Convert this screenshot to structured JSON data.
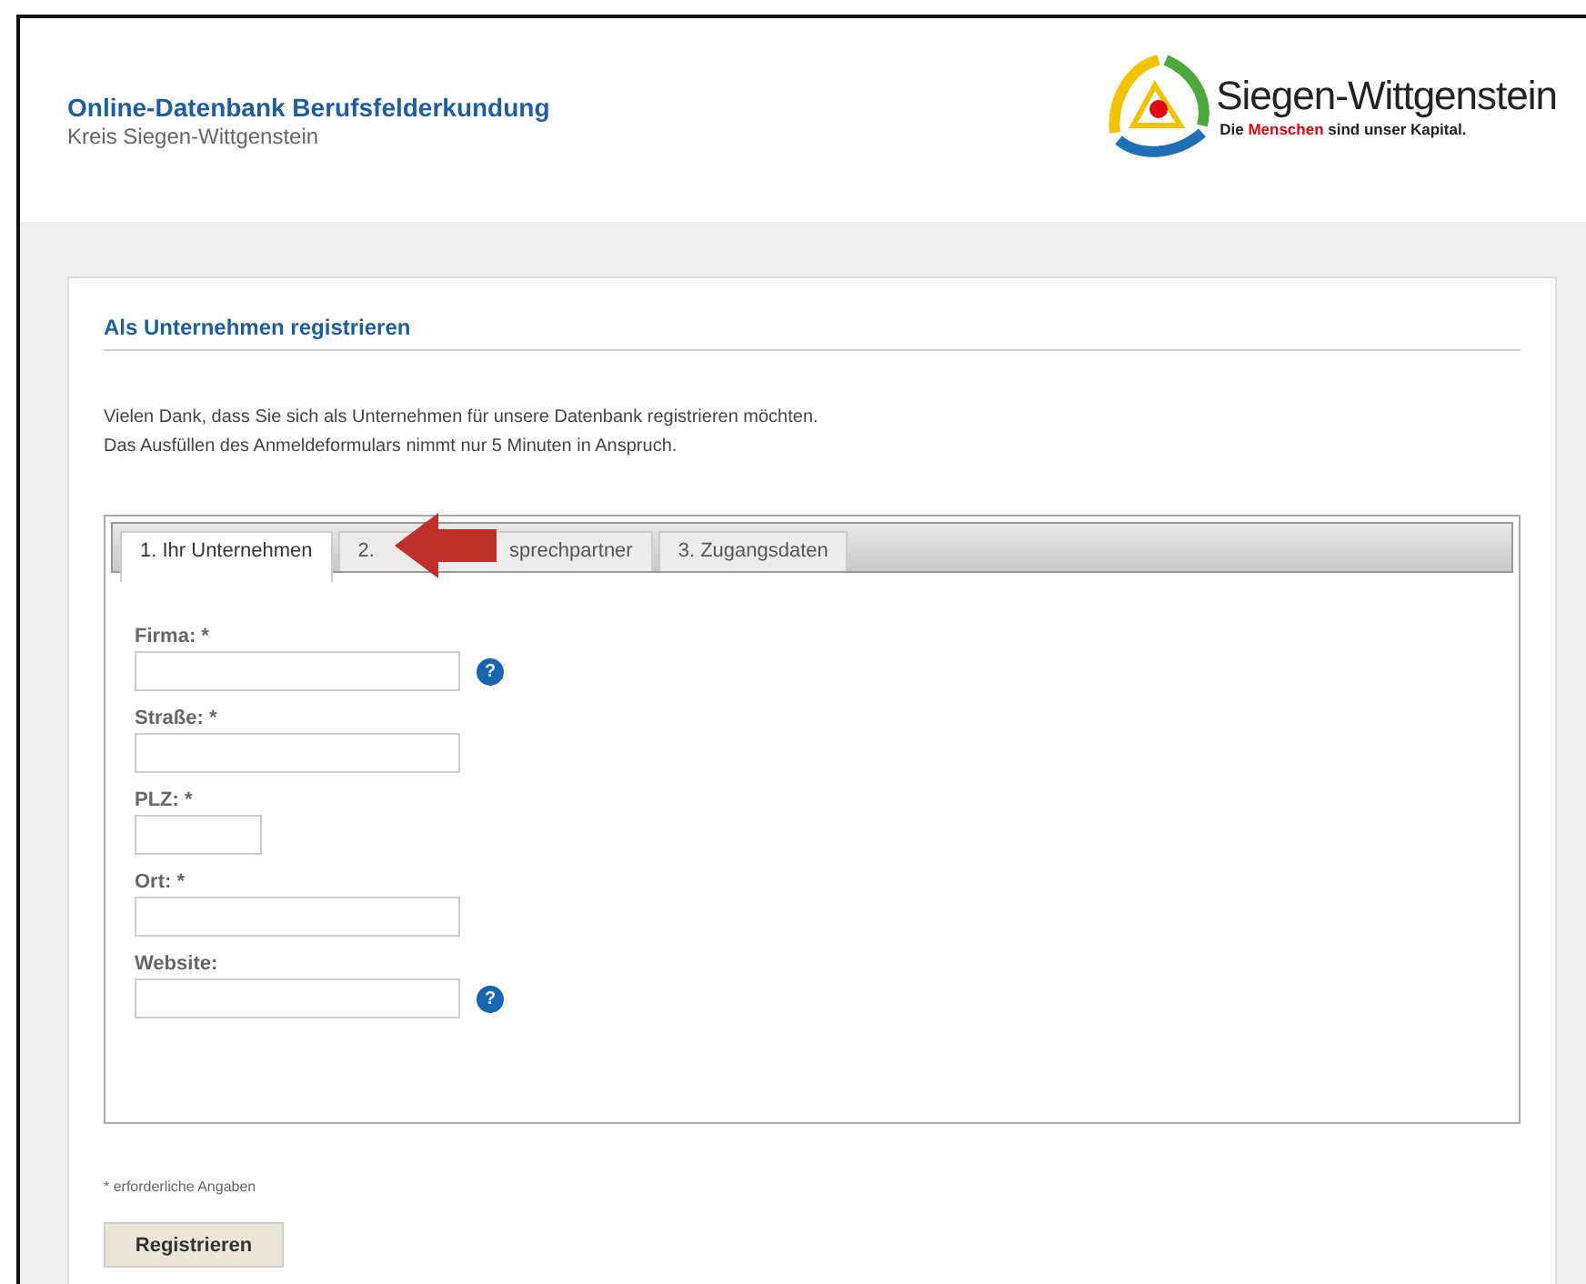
{
  "header": {
    "title": "Online-Datenbank Berufsfelderkundung",
    "subtitle": "Kreis Siegen-Wittgenstein",
    "logo": {
      "name": "Siegen-Wittgenstein",
      "slogan_start": "Die ",
      "slogan_highlight": "Menschen",
      "slogan_end": " sind unser Kapital."
    }
  },
  "section_title": "Als Unternehmen registrieren",
  "intro": [
    "Vielen Dank, dass Sie sich als Unternehmen für unsere Datenbank registrieren möchten.",
    "Das Ausfüllen des Anmeldeformulars nimmt nur 5 Minuten in Anspruch."
  ],
  "tabs": [
    {
      "label": "1. Ihr Unternehmen",
      "selected": true
    },
    {
      "label": "2.",
      "label_after_arrow": "sprechpartner",
      "selected": false
    },
    {
      "label": "3. Zugangsdaten",
      "selected": false
    }
  ],
  "fields": [
    {
      "label": "Firma: *",
      "kind": "wide",
      "help": true
    },
    {
      "label": "Straße: *",
      "kind": "wide",
      "help": false
    },
    {
      "label": "PLZ: *",
      "kind": "short",
      "help": false
    },
    {
      "label": "Ort: *",
      "kind": "wide",
      "help": false
    },
    {
      "label": "Website:",
      "kind": "wide",
      "help": true
    }
  ],
  "help_icon_text": "?",
  "footnote": "* erforderliche Angaben",
  "submit": "Registrieren"
}
